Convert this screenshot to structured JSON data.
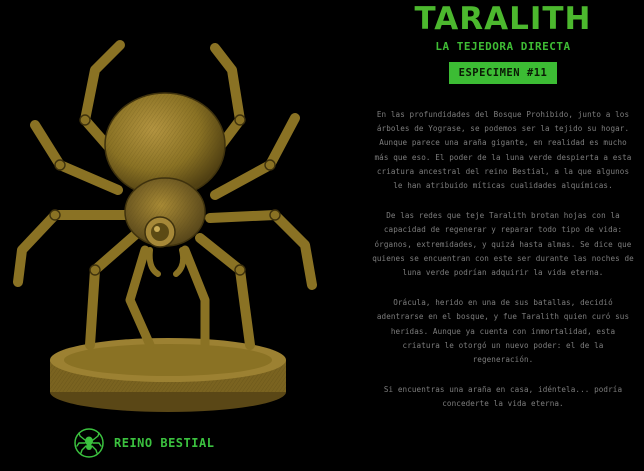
{
  "title": "TARALITH",
  "subtitle": "LA TEJEDORA DIRECTA",
  "badge": "ESPECIMEN #11",
  "paragraphs": [
    "En las profundidades del Bosque Prohibido, junto a los árboles de Yograse, se podemos ser la tejido su hogar. Aunque parece una araña gigante, en realidad es mucho más que eso. El poder de la luna verde despierta a esta criatura ancestral del reino Bestial, a la que algunos le han atribuido míticas cualidades alquímicas.",
    "De las redes que teje Taralith brotan hojas con la capacidad de regenerar y reparar todo tipo de vida: órganos, extremidades, y quizá hasta almas. Se dice que quienes se encuentran con este ser durante las noches de luna verde podrían adquirir la vida eterna.",
    "Orácula, herido en una de sus batallas, decidió adentrarse en el bosque, y fue Taralith quien curó sus heridas. Aunque ya cuenta con inmortalidad, esta criatura le otorgó un nuevo poder: el de la regeneración.",
    "Si encuentras una araña en casa, idéntela... podría concederte la vida eterna."
  ],
  "footer": {
    "brand": "REINO BESTIAL",
    "logo_icon": "spider-emblem-icon"
  },
  "colors": {
    "background": "#000000",
    "accent_green": "#3cbc34",
    "illustration": "#8a7224",
    "text": "#7d7d7d"
  }
}
